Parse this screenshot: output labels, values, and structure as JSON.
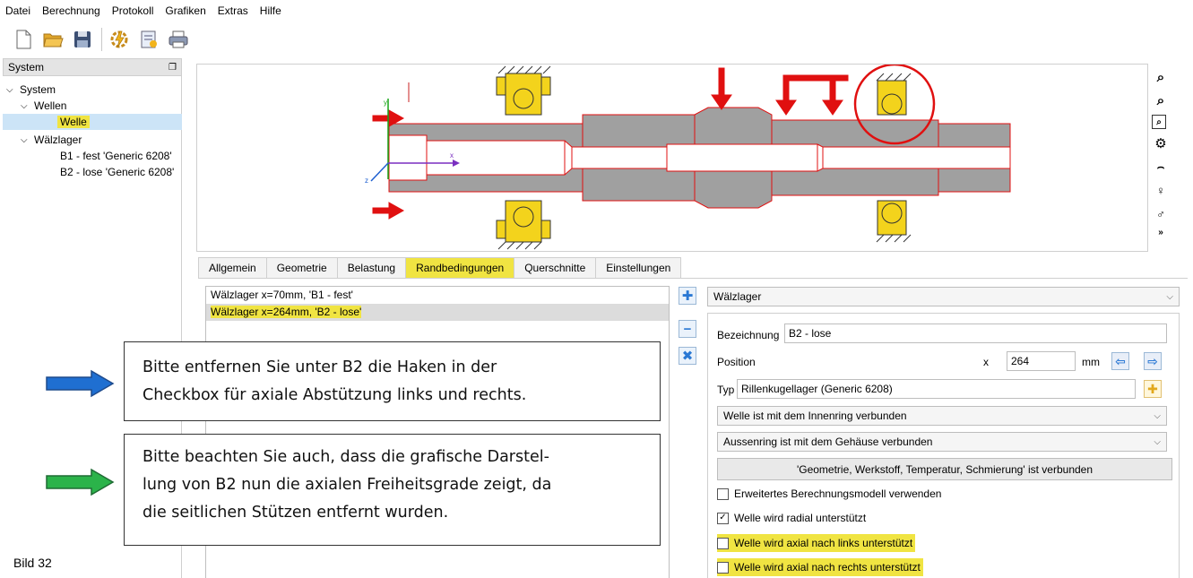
{
  "menu": [
    "Datei",
    "Berechnung",
    "Protokoll",
    "Grafiken",
    "Extras",
    "Hilfe"
  ],
  "toolbar": {
    "icons": [
      "new-file-icon",
      "open-folder-icon",
      "save-icon",
      "calculate-icon",
      "report-icon",
      "print-icon"
    ]
  },
  "system_panel": {
    "header": "System",
    "tree": {
      "root": "System",
      "shafts_group": "Wellen",
      "shaft": "Welle",
      "bearings_group": "Wälzlager",
      "bearing_1": "B1 - fest 'Generic 6208'",
      "bearing_2": "B2 - lose 'Generic 6208'"
    }
  },
  "side_tools": [
    "zoom-in-icon",
    "zoom-out-icon",
    "zoom-fit-icon",
    "settings-gear-icon",
    "view-icon",
    "bearing-view-icon",
    "bearing-add-icon",
    "more-icon"
  ],
  "tabs": [
    "Allgemein",
    "Geometrie",
    "Belastung",
    "Randbedingungen",
    "Querschnitte",
    "Einstellungen"
  ],
  "active_tab": "Randbedingungen",
  "boundary_list": [
    "Wälzlager x=70mm, 'B1 - fest'",
    "Wälzlager x=264mm, 'B2 - lose'"
  ],
  "element_type": "Wälzlager",
  "form": {
    "bezeichnung_label": "Bezeichnung",
    "bezeichnung_value": "B2 - lose",
    "position_label": "Position",
    "position_axis": "x",
    "position_value": "264",
    "position_unit": "mm",
    "typ_label": "Typ",
    "typ_value": "Rillenkugellager (Generic 6208)",
    "inner_ring": "Welle ist mit dem Innenring verbunden",
    "outer_ring": "Aussenring ist mit dem Gehäuse verbunden",
    "connected_button": "'Geometrie, Werkstoff, Temperatur, Schmierung' ist verbunden",
    "checkboxes": [
      {
        "label": "Erweitertes Berechnungsmodell verwenden",
        "checked": false
      },
      {
        "label": "Welle wird radial unterstützt",
        "checked": true
      },
      {
        "label": "Welle wird axial nach links unterstützt",
        "checked": false
      },
      {
        "label": "Welle wird axial nach rechts unterstützt",
        "checked": false
      }
    ]
  },
  "callouts": {
    "first": [
      "Bitte entfernen Sie unter B2 die Haken in der",
      "Checkbox für axiale Abstützung links und rechts."
    ],
    "second": [
      "Bitte beachten Sie auch, dass die grafische Darstel-",
      "lung von B2 nun die axialen Freiheitsgrade zeigt, da",
      "die seitlichen Stützen entfernt wurden."
    ]
  },
  "figure_label": "Bild 32",
  "colors": {
    "highlight": "#f0e442",
    "shaft_fill": "#a0a0a0",
    "outline": "#e01010",
    "load_arrow": "#e01010",
    "blue_arrow": "#1f6fd1",
    "green_arrow": "#2bb34a"
  },
  "axis_labels": {
    "x": "x",
    "y": "y",
    "z": "z"
  }
}
